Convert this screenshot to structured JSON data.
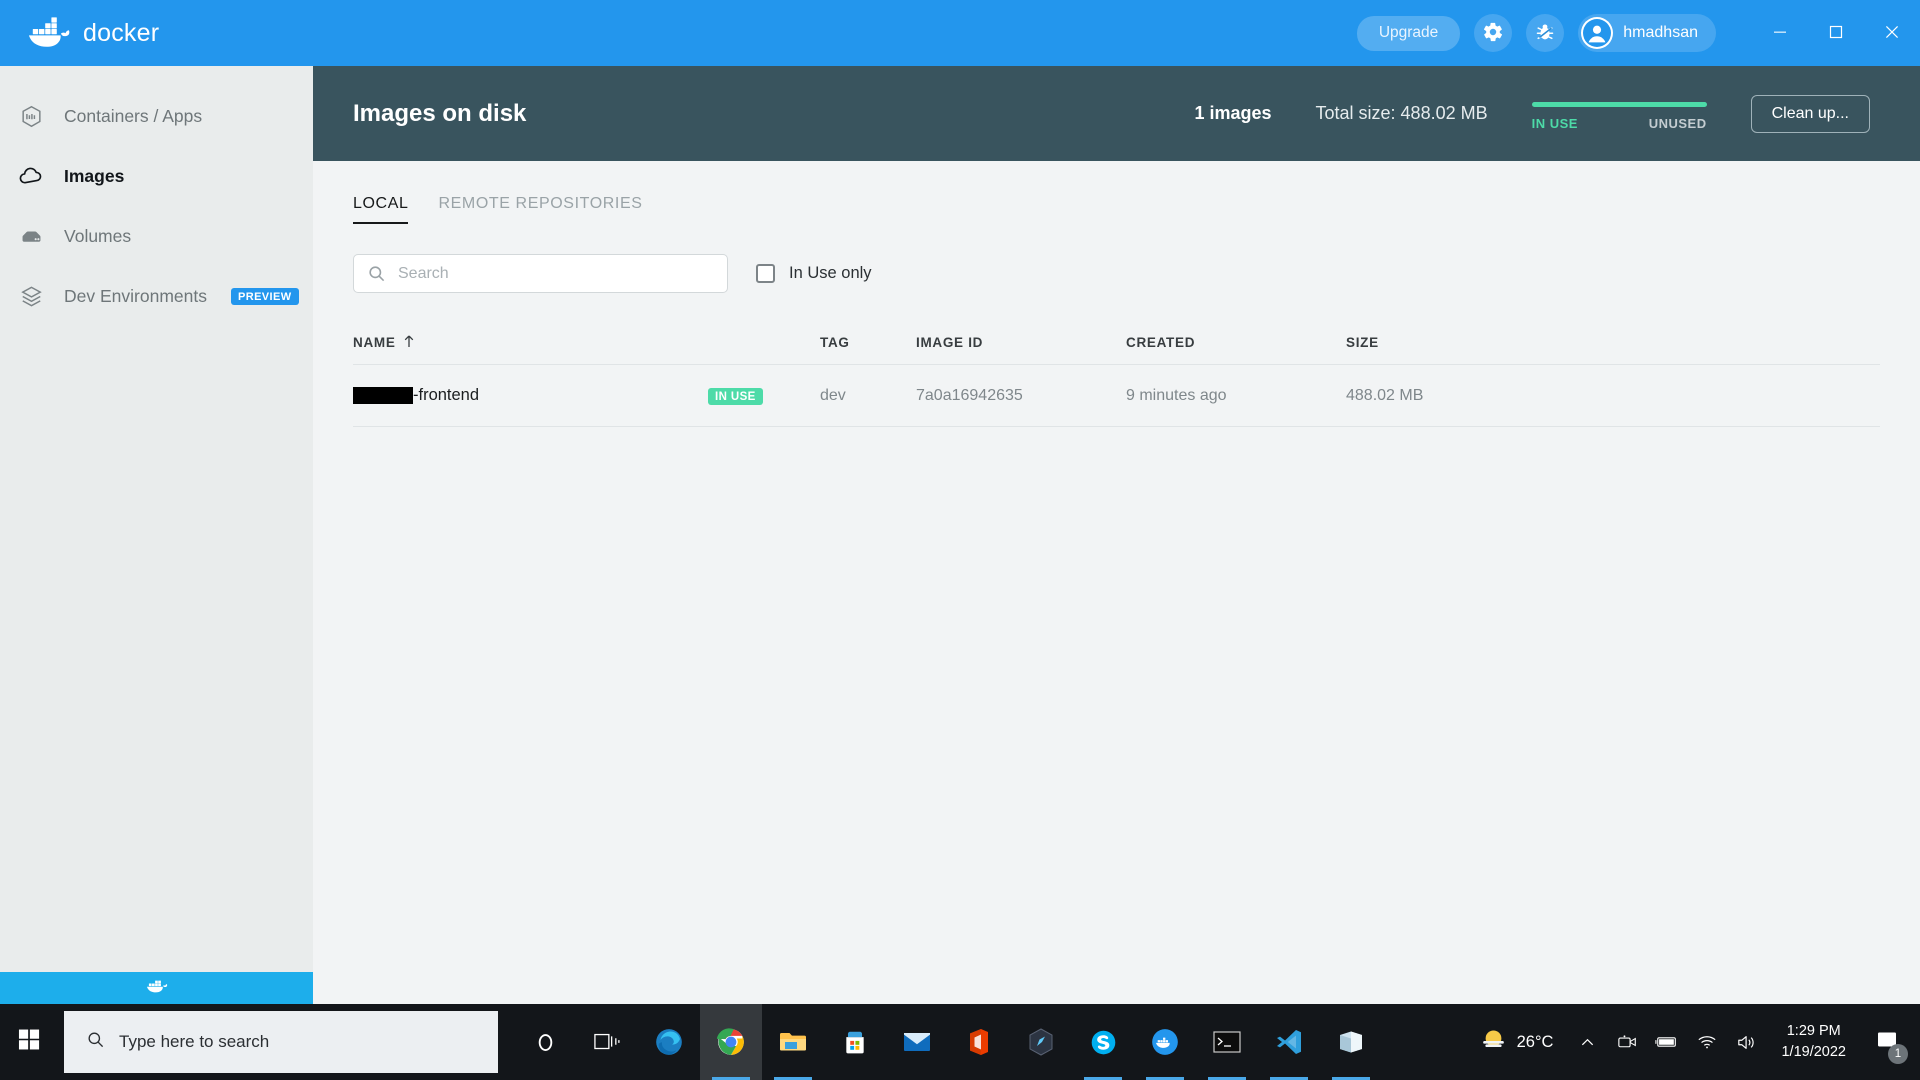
{
  "titlebar": {
    "brand": "docker",
    "logo_icon": "docker-whale-logo",
    "upgrade_label": "Upgrade",
    "settings_icon": "gear-icon",
    "troubleshoot_icon": "bug-icon",
    "avatar_icon": "user-avatar-icon",
    "username": "hmadhsan",
    "minimize_icon": "minimize-icon",
    "maximize_icon": "maximize-icon",
    "close_icon": "close-icon",
    "accent_color": "#2396ed"
  },
  "sidebar": {
    "items": [
      {
        "label": "Containers / Apps",
        "icon": "container-box-icon",
        "active": false,
        "badge": ""
      },
      {
        "label": "Images",
        "icon": "cloud-icon",
        "active": true,
        "badge": ""
      },
      {
        "label": "Volumes",
        "icon": "volume-drive-icon",
        "active": false,
        "badge": ""
      },
      {
        "label": "Dev Environments",
        "icon": "layers-icon",
        "active": false,
        "badge": "PREVIEW"
      }
    ],
    "footer_icon": "docker-whale-small-icon",
    "footer_color": "#1daeeb"
  },
  "header": {
    "title": "Images on disk",
    "image_count": "1 images",
    "total_size": "Total size: 488.02 MB",
    "usage": {
      "in_use_label": "IN USE",
      "unused_label": "UNUSED",
      "in_use_percent": 100,
      "bar_color": "#4ddba8"
    },
    "cleanup_label": "Clean up...",
    "background_color": "#39545e"
  },
  "tabs": [
    {
      "label": "LOCAL",
      "active": true
    },
    {
      "label": "REMOTE REPOSITORIES",
      "active": false
    }
  ],
  "filters": {
    "search_placeholder": "Search",
    "search_value": "",
    "search_icon": "search-icon",
    "in_use_only_label": "In Use only",
    "in_use_only_checked": false
  },
  "table": {
    "columns": [
      "NAME",
      "TAG",
      "IMAGE ID",
      "CREATED",
      "SIZE"
    ],
    "sort_column": "NAME",
    "sort_direction": "ascending",
    "sort_icon": "arrow-up-icon",
    "rows": [
      {
        "name_redacted": true,
        "name_suffix": "-frontend",
        "badge": "IN USE",
        "tag": "dev",
        "image_id": "7a0a16942635",
        "created": "9 minutes ago",
        "size": "488.02 MB"
      }
    ]
  },
  "taskbar": {
    "start_icon": "windows-start-icon",
    "search_placeholder": "Type here to search",
    "search_icon": "search-icon",
    "apps": [
      {
        "name": "cortana-icon",
        "active": false,
        "running": false
      },
      {
        "name": "task-view-icon",
        "active": false,
        "running": false
      },
      {
        "name": "microsoft-edge-icon",
        "active": false,
        "running": false
      },
      {
        "name": "google-chrome-icon",
        "active": true,
        "running": true
      },
      {
        "name": "file-explorer-icon",
        "active": false,
        "running": true
      },
      {
        "name": "microsoft-store-icon",
        "active": false,
        "running": false
      },
      {
        "name": "mail-icon",
        "active": false,
        "running": false
      },
      {
        "name": "microsoft-office-icon",
        "active": false,
        "running": false
      },
      {
        "name": "postman-icon",
        "active": false,
        "running": false
      },
      {
        "name": "skype-icon",
        "active": false,
        "running": true
      },
      {
        "name": "docker-desktop-icon",
        "active": false,
        "running": true
      },
      {
        "name": "terminal-icon",
        "active": false,
        "running": true
      },
      {
        "name": "visual-studio-code-icon",
        "active": false,
        "running": true
      },
      {
        "name": "sticky-notes-icon",
        "active": false,
        "running": true
      }
    ],
    "weather": {
      "temperature": "26°C",
      "icon": "partly-sunny-icon"
    },
    "tray": [
      "chevron-up-icon",
      "camera-icon",
      "battery-icon",
      "wifi-icon",
      "volume-icon"
    ],
    "time": "1:29 PM",
    "date": "1/19/2022",
    "notification_icon": "notification-icon",
    "notification_count": "1"
  }
}
